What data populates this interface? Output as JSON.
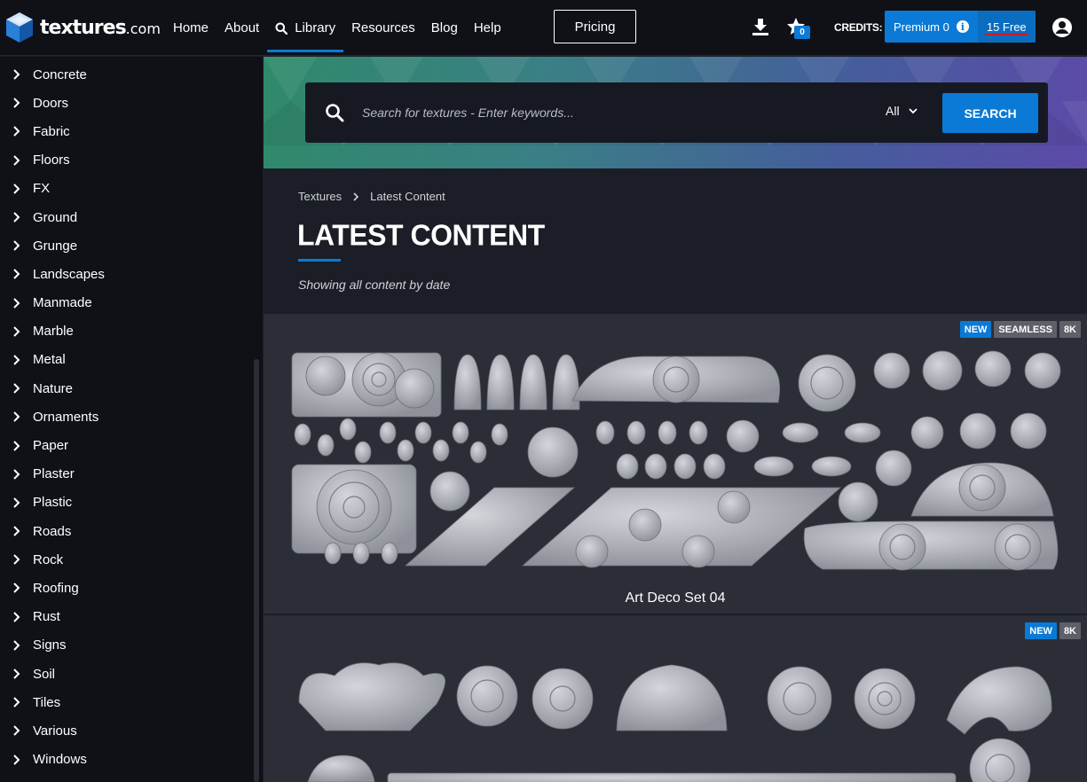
{
  "brand": {
    "name": "textures",
    "suffix": ".com"
  },
  "nav": {
    "items": [
      {
        "label": "Home"
      },
      {
        "label": "About"
      },
      {
        "label": "Library"
      },
      {
        "label": "Resources"
      },
      {
        "label": "Blog"
      },
      {
        "label": "Help"
      }
    ],
    "pricing_label": "Pricing",
    "favorites_count": "0",
    "credits_label": "CREDITS:",
    "premium_credits": "Premium 0",
    "free_credits": "15 Free"
  },
  "sidebar": {
    "categories": [
      "Concrete",
      "Doors",
      "Fabric",
      "Floors",
      "FX",
      "Ground",
      "Grunge",
      "Landscapes",
      "Manmade",
      "Marble",
      "Metal",
      "Nature",
      "Ornaments",
      "Paper",
      "Plaster",
      "Plastic",
      "Roads",
      "Rock",
      "Roofing",
      "Rust",
      "Signs",
      "Soil",
      "Tiles",
      "Various",
      "Windows"
    ]
  },
  "search": {
    "placeholder": "Search for textures - Enter keywords...",
    "filter_value": "All",
    "button_label": "SEARCH"
  },
  "breadcrumb": {
    "root": "Textures",
    "current": "Latest Content"
  },
  "page": {
    "title": "LATEST CONTENT",
    "subtitle": "Showing all content by date"
  },
  "cards": [
    {
      "title": "Art Deco Set 04",
      "badges": [
        "NEW",
        "SEAMLESS",
        "8K"
      ]
    },
    {
      "title": "",
      "badges": [
        "NEW",
        "8K"
      ]
    }
  ],
  "colors": {
    "accent": "#0a7ad6",
    "nav_bg": "#0f1117",
    "card_bg": "#2b2e37",
    "badge_grey": "#5d6068",
    "underline_red": "#d11a1a"
  }
}
